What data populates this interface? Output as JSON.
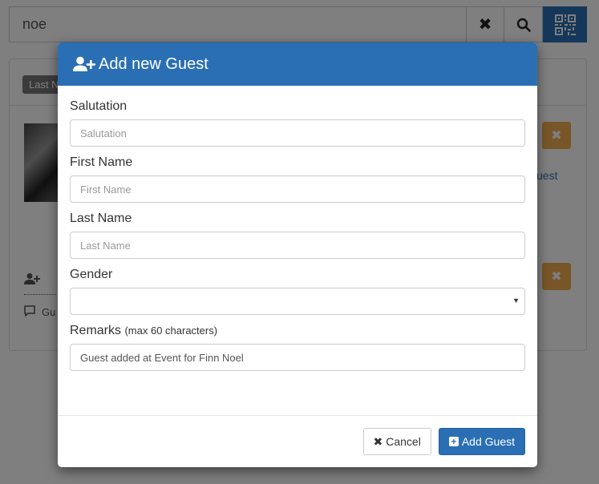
{
  "search": {
    "value": "noe"
  },
  "background": {
    "tag_label": "Last N",
    "guest_link": "uest",
    "row_text": "Gu"
  },
  "modal": {
    "title": "Add new Guest",
    "fields": {
      "salutation": {
        "label": "Salutation",
        "placeholder": "Salutation"
      },
      "first_name": {
        "label": "First Name",
        "placeholder": "First Name"
      },
      "last_name": {
        "label": "Last Name",
        "placeholder": "Last Name"
      },
      "gender": {
        "label": "Gender",
        "value": ""
      },
      "remarks": {
        "label": "Remarks",
        "hint": "(max 60 characters)",
        "value": "Guest added at Event for Finn Noel"
      }
    },
    "buttons": {
      "cancel": "Cancel",
      "add": "Add Guest"
    }
  },
  "colors": {
    "primary": "#2a6fb4",
    "warning": "#f0ad4e"
  },
  "icons": [
    "clear-icon",
    "search-icon",
    "qr-code-icon",
    "add-user-icon",
    "close-icon",
    "plus-square-icon",
    "comment-icon"
  ]
}
